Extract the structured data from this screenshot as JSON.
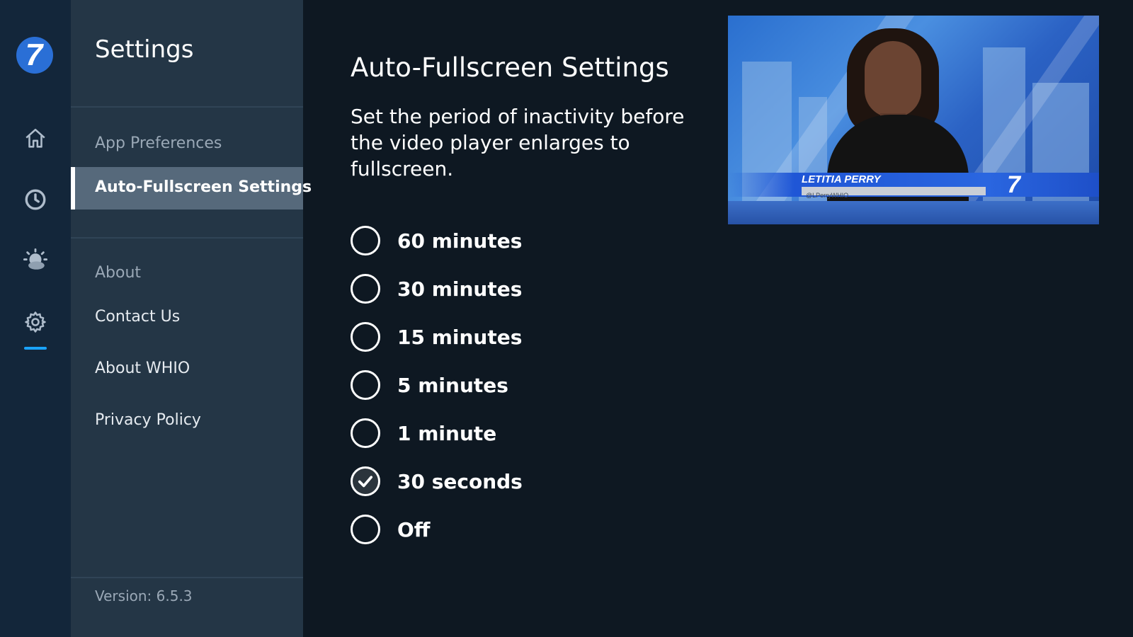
{
  "rail": {
    "logo_text": "7",
    "icons": [
      "home-icon",
      "clock-icon",
      "weather-icon",
      "gear-icon"
    ],
    "active_indicator_color": "#1aa3ff"
  },
  "panel": {
    "title": "Settings",
    "section_app": "App Preferences",
    "selected_item": "Auto-Fullscreen Settings",
    "section_about": "About",
    "items": [
      "Contact Us",
      "About WHIO",
      "Privacy Policy"
    ],
    "version": "Version: 6.5.3"
  },
  "main": {
    "title": "Auto-Fullscreen Settings",
    "description": "Set the period of inactivity before the video player enlarges to fullscreen.",
    "options": [
      {
        "label": "60 minutes",
        "checked": false
      },
      {
        "label": "30 minutes",
        "checked": false
      },
      {
        "label": "15 minutes",
        "checked": false
      },
      {
        "label": "5 minutes",
        "checked": false
      },
      {
        "label": "1 minute",
        "checked": false
      },
      {
        "label": "30 seconds",
        "checked": true
      },
      {
        "label": "Off",
        "checked": false
      }
    ]
  },
  "video": {
    "lower_third_name": "LETITIA PERRY",
    "lower_third_sub": "@LPerryWHIO",
    "channel_logo": "7"
  },
  "colors": {
    "background": "#0e1822",
    "rail": "#13263a",
    "panel": "#243646",
    "selected": "#56697b",
    "accent": "#1aa3ff"
  }
}
